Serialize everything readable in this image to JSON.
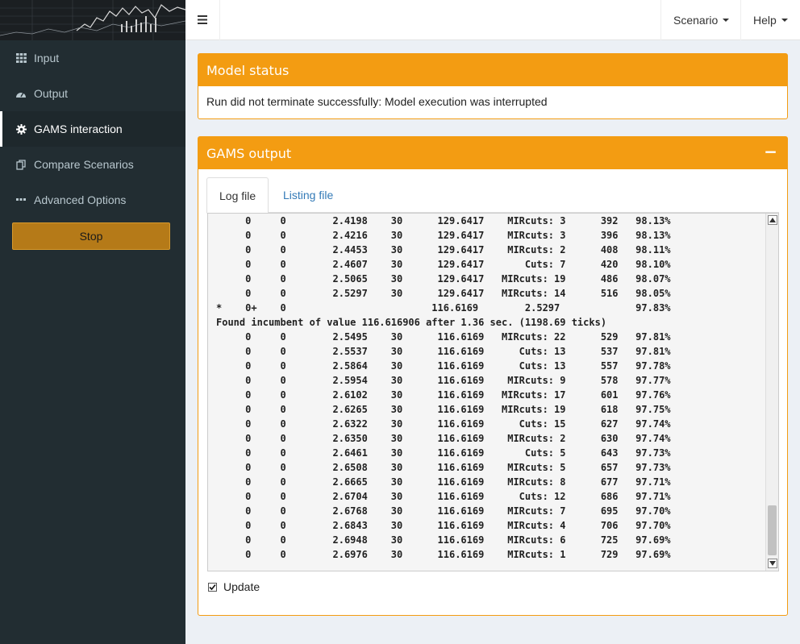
{
  "sidebar": {
    "items": [
      {
        "label": "Input",
        "icon": "grid-icon"
      },
      {
        "label": "Output",
        "icon": "dashboard-icon"
      },
      {
        "label": "GAMS interaction",
        "icon": "gear-icon"
      },
      {
        "label": "Compare Scenarios",
        "icon": "copy-icon"
      },
      {
        "label": "Advanced Options",
        "icon": "ellipsis-icon"
      }
    ],
    "active_item": "GAMS interaction",
    "stop_label": "Stop"
  },
  "header": {
    "scenario_label": "Scenario",
    "help_label": "Help"
  },
  "model_status": {
    "title": "Model status",
    "message": "Run did not terminate successfully: Model execution was interrupted"
  },
  "gams_output": {
    "title": "GAMS output",
    "collapse_label": "−",
    "tabs": [
      {
        "label": "Log file",
        "active": true
      },
      {
        "label": "Listing file",
        "active": false
      }
    ],
    "log_lines": [
      "     0     0        2.4198    30      129.6417    MIRcuts: 3      392   98.13%",
      "     0     0        2.4216    30      129.6417    MIRcuts: 3      396   98.13%",
      "     0     0        2.4453    30      129.6417    MIRcuts: 2      408   98.11%",
      "     0     0        2.4607    30      129.6417       Cuts: 7      420   98.10%",
      "     0     0        2.5065    30      129.6417   MIRcuts: 19      486   98.07%",
      "     0     0        2.5297    30      129.6417   MIRcuts: 14      516   98.05%",
      "*    0+    0                         116.6169        2.5297             97.83%",
      "Found incumbent of value 116.616906 after 1.36 sec. (1198.69 ticks)",
      "     0     0        2.5495    30      116.6169   MIRcuts: 22      529   97.81%",
      "     0     0        2.5537    30      116.6169      Cuts: 13      537   97.81%",
      "     0     0        2.5864    30      116.6169      Cuts: 13      557   97.78%",
      "     0     0        2.5954    30      116.6169    MIRcuts: 9      578   97.77%",
      "     0     0        2.6102    30      116.6169   MIRcuts: 17      601   97.76%",
      "     0     0        2.6265    30      116.6169   MIRcuts: 19      618   97.75%",
      "     0     0        2.6322    30      116.6169      Cuts: 15      627   97.74%",
      "     0     0        2.6350    30      116.6169    MIRcuts: 2      630   97.74%",
      "     0     0        2.6461    30      116.6169       Cuts: 5      643   97.73%",
      "     0     0        2.6508    30      116.6169    MIRcuts: 5      657   97.73%",
      "     0     0        2.6665    30      116.6169    MIRcuts: 8      677   97.71%",
      "     0     0        2.6704    30      116.6169      Cuts: 12      686   97.71%",
      "     0     0        2.6768    30      116.6169    MIRcuts: 7      695   97.70%",
      "     0     0        2.6843    30      116.6169    MIRcuts: 4      706   97.70%",
      "     0     0        2.6948    30      116.6169    MIRcuts: 6      725   97.69%",
      "     0     0        2.6976    30      116.6169    MIRcuts: 1      729   97.69%"
    ],
    "update_label": "Update",
    "update_checked": true
  },
  "colors": {
    "accent": "#f39c12",
    "sidebar_bg": "#222d32",
    "stop_button": "#b57a18",
    "link": "#337ab7"
  }
}
